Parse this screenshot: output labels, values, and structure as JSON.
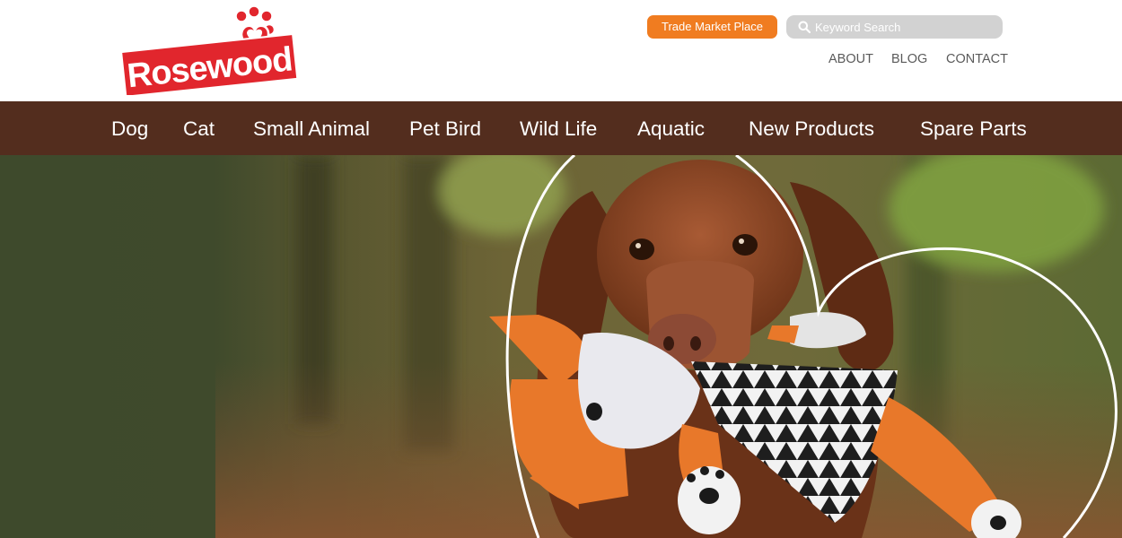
{
  "header": {
    "logo_text": "Rosewood",
    "trade_button_label": "Trade Market Place",
    "search": {
      "placeholder": "Keyword Search",
      "value": ""
    },
    "utility_links": [
      {
        "label": "ABOUT"
      },
      {
        "label": "BLOG"
      },
      {
        "label": "CONTACT"
      }
    ]
  },
  "main_nav": {
    "items": [
      {
        "label": "Dog"
      },
      {
        "label": "Cat"
      },
      {
        "label": "Small Animal"
      },
      {
        "label": "Pet Bird"
      },
      {
        "label": "Wild Life"
      },
      {
        "label": "Aquatic"
      },
      {
        "label": "New Products"
      },
      {
        "label": "Spare Parts"
      }
    ]
  },
  "hero": {
    "image_icon": "dachshund-with-fox-toy-photo"
  },
  "colors": {
    "brand_red": "#e1262d",
    "accent_orange": "#f07c20",
    "nav_brown": "#532d1e",
    "search_gray": "#d2d2d2"
  }
}
